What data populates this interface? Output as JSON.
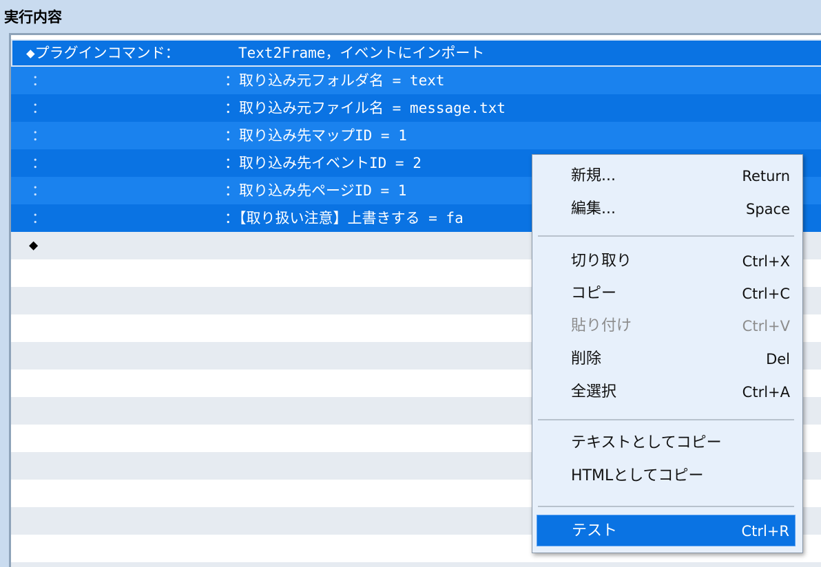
{
  "section": {
    "title": "実行内容"
  },
  "command_rows": [
    {
      "prefix": "◆プラグインコマンド：",
      "param": "Text2Frame，イベントにインポート"
    },
    {
      "prefix": "：",
      "param": "：取り込み元フォルダ名 = text"
    },
    {
      "prefix": "：",
      "param": "：取り込み元ファイル名 = message.txt"
    },
    {
      "prefix": "：",
      "param": "：取り込み先マップID = 1"
    },
    {
      "prefix": "：",
      "param": "：取り込み先イベントID = 2"
    },
    {
      "prefix": "：",
      "param": "：取り込み先ページID = 1"
    },
    {
      "prefix": "：",
      "param": "：【取り扱い注意】上書きする = fa"
    }
  ],
  "end_marker": "◆",
  "context_menu": {
    "items": [
      {
        "label": "新規...",
        "shortcut": "Return"
      },
      {
        "label": "編集...",
        "shortcut": "Space"
      },
      {
        "label": "切り取り",
        "shortcut": "Ctrl+X"
      },
      {
        "label": "コピー",
        "shortcut": "Ctrl+C"
      },
      {
        "label": "貼り付け",
        "shortcut": "Ctrl+V",
        "disabled": true
      },
      {
        "label": "削除",
        "shortcut": "Del"
      },
      {
        "label": "全選択",
        "shortcut": "Ctrl+A"
      },
      {
        "label": "テキストとしてコピー",
        "shortcut": ""
      },
      {
        "label": "HTMLとしてコピー",
        "shortcut": ""
      },
      {
        "label": "テスト",
        "shortcut": "Ctrl+R",
        "highlighted": true
      }
    ]
  },
  "colors": {
    "selection": "#0a73e3",
    "menu_background": "#e7f0fb",
    "window_background": "#c9dbef"
  }
}
